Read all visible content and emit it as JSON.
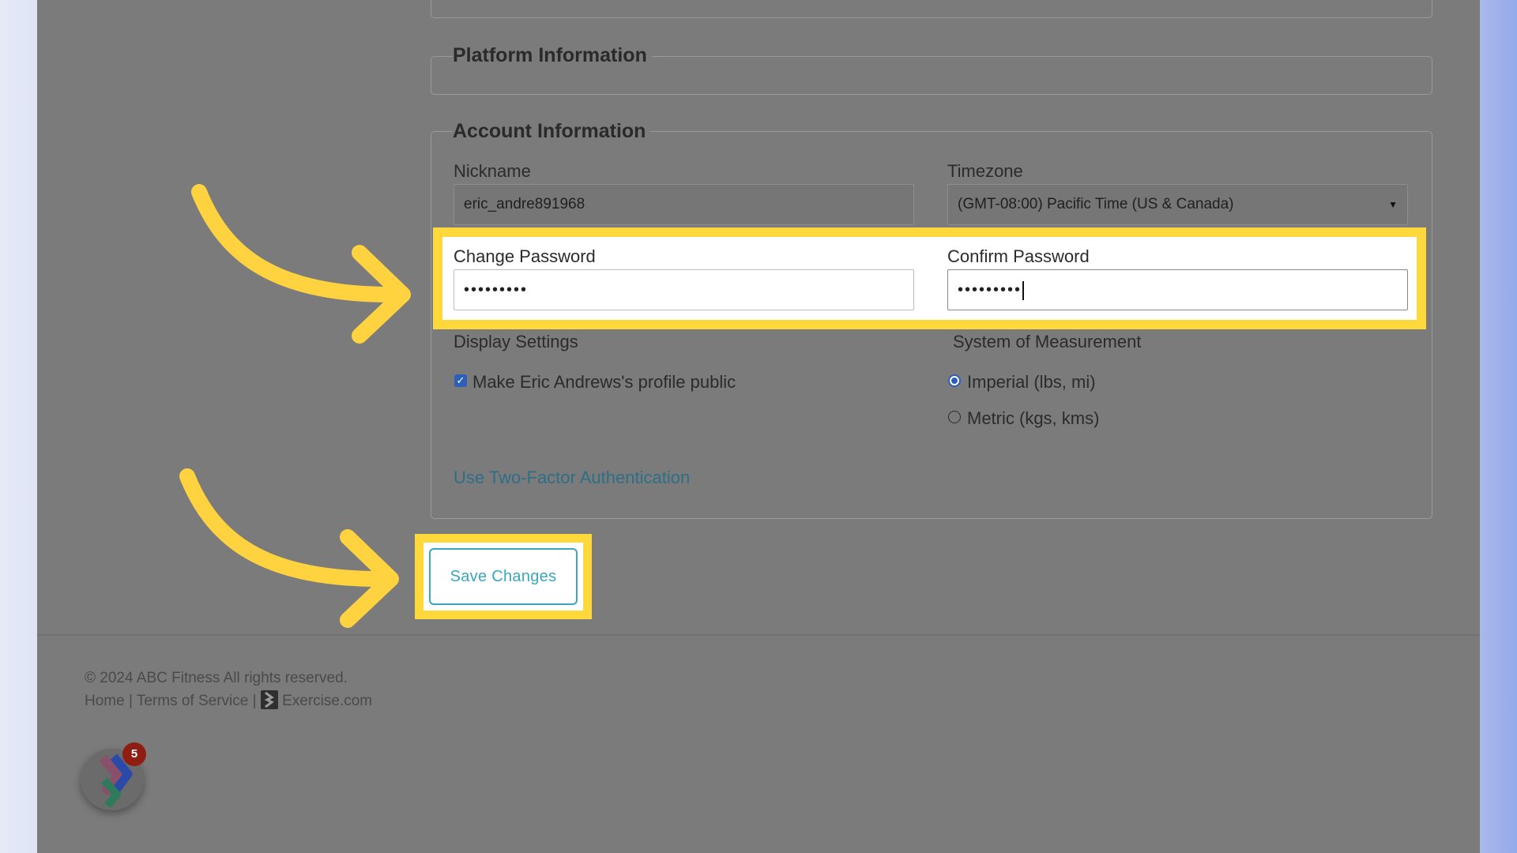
{
  "sections": {
    "platform_legend": "Platform Information",
    "account_legend": "Account Information"
  },
  "account": {
    "nickname_label": "Nickname",
    "nickname_value": "eric_andre891968",
    "timezone_label": "Timezone",
    "timezone_value": "(GMT-08:00) Pacific Time (US & Canada)",
    "change_password_label": "Change Password",
    "change_password_value": "•••••••••",
    "confirm_password_label": "Confirm Password",
    "confirm_password_value": "•••••••••",
    "display_settings_label": "Display Settings",
    "profile_public_label": "Make Eric Andrews's profile public",
    "profile_public_checked": true,
    "measurement_label": "System of Measurement",
    "measurement_options": [
      {
        "label": "Imperial (lbs, mi)",
        "selected": true
      },
      {
        "label": "Metric (kgs, kms)",
        "selected": false
      }
    ],
    "two_factor_link": "Use Two-Factor Authentication",
    "save_label": "Save Changes"
  },
  "footer": {
    "copyright": "© 2024 ABC Fitness All rights reserved.",
    "links": {
      "home": "Home",
      "sep1": "|",
      "terms": "Terms of Service",
      "sep2": "|",
      "exercise": "Exercise.com"
    }
  },
  "widget": {
    "badge_count": "5"
  },
  "colors": {
    "highlight": "#ffd93b",
    "annotation_arrow": "#ffd23f",
    "accent_link": "#3aa5bf",
    "checkbox": "#2d5fb8",
    "badge": "#8f1d14"
  },
  "icons": {
    "dropdown": "caret-down-icon",
    "arrows": "curved-arrow-icon",
    "exercise_logo": "exercise-logo-icon"
  }
}
